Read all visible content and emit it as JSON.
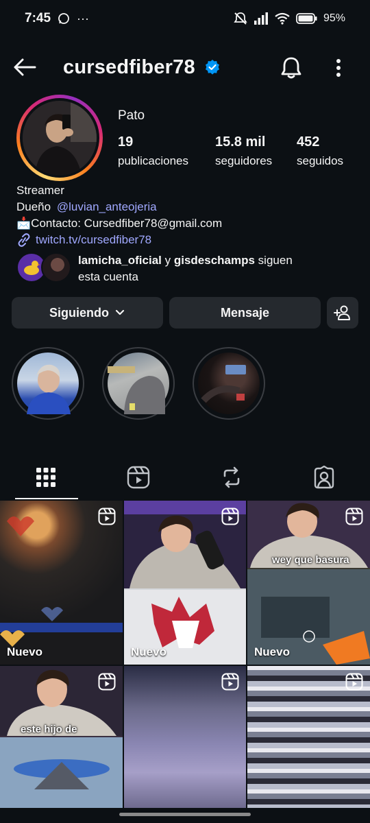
{
  "status": {
    "time": "7:45",
    "dots": "···",
    "battery": "95%"
  },
  "header": {
    "username": "cursedfiber78"
  },
  "profile": {
    "name": "Pato",
    "stats": [
      {
        "num": "19",
        "label": "publicaciones"
      },
      {
        "num": "15.8 mil",
        "label": "seguidores"
      },
      {
        "num": "452",
        "label": "seguidos"
      }
    ],
    "bio": {
      "line1": "Streamer",
      "line2_prefix": "Dueño ",
      "line2_mention": "@luvian_anteojeria",
      "line3": "📩Contacto: Cursedfiber78@gmail.com",
      "link": "twitch.tv/cursedfiber78"
    },
    "followed_by": {
      "user1": "lamicha_oficial",
      "connector": " y ",
      "user2": "gisdeschamps",
      "suffix1": " siguen",
      "suffix2": "esta cuenta"
    }
  },
  "actions": {
    "following": "Siguiendo",
    "message": "Mensaje"
  },
  "grid": {
    "new_label": "Nuevo",
    "caption_1": "wey que basura",
    "caption_2": "este hijo de "
  },
  "colors": {
    "background": "#0c1014",
    "button": "#25292e",
    "link": "#a0a8ff",
    "verified": "#0095f6"
  }
}
